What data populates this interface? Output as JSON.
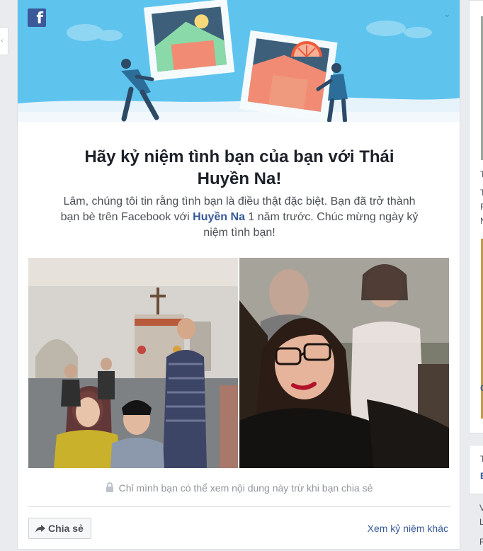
{
  "card": {
    "title": "Hãy kỷ niệm tình bạn của bạn với Thái Huyền Na!",
    "message_before": "Lâm, chúng tôi tin rằng tình bạn là điều thật đặc biệt. Bạn đã trở thành bạn bè trên Facebook với ",
    "friend_name": "Huyền Na",
    "message_after": " 1 năm trước. Chúc mừng ngày kỷ niệm tình bạn!",
    "privacy_note": "Chỉ mình bạn có thể xem nội dung này trừ khi bạn chia sẻ",
    "share_label": "Chia sẻ",
    "see_more_label": "Xem kỷ niệm khác"
  },
  "icons": {
    "logo": "facebook-logo",
    "menu": "chevron-down-icon",
    "privacy": "lock-icon",
    "share": "share-arrow-icon"
  },
  "colors": {
    "banner": "#5ec4ee",
    "brand": "#3b5998",
    "link": "#365899",
    "text_dark": "#1d2129",
    "text_muted": "#90949c"
  },
  "right_column": {
    "fragments": [
      "T",
      "T",
      "F",
      "N",
      "C",
      "T",
      "E",
      "V",
      "L",
      "F"
    ]
  }
}
